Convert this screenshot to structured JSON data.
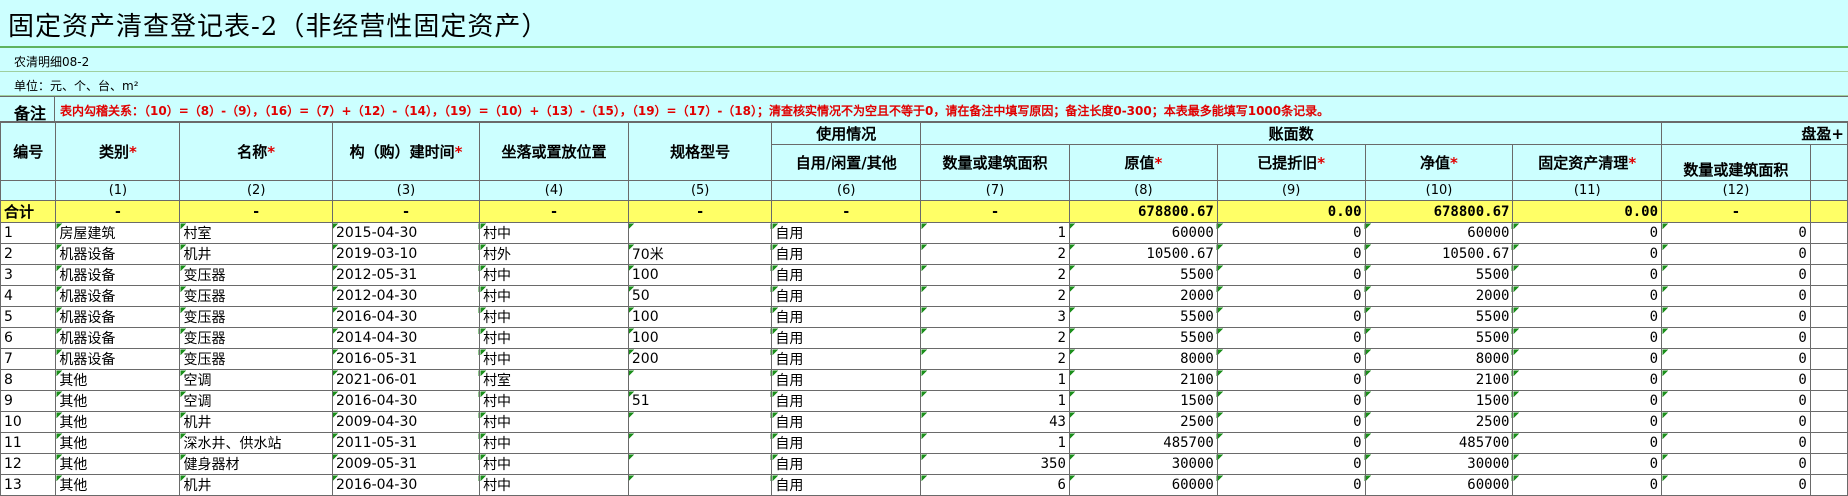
{
  "title": "固定资产清查登记表-2（非经营性固定资产）",
  "form_code": "农清明细08-2",
  "unit_line": "单位：元、个、台、m²",
  "note_label": "备注",
  "note_text": "表内勾稽关系：（10）=（8）-（9），（16）=（7）+（12）-（14），（19）=（10）+（13）-（15），（19）=（17）-（18）；清查核实情况不为空且不等于0，请在备注中填写原因；备注长度0-300；本表最多能填写1000条记录。",
  "headers": {
    "no": "编号",
    "category": "类别",
    "name": "名称",
    "build_time": "构（购）建时间",
    "location": "坐落或置放位置",
    "spec": "规格型号",
    "usage_group": "使用情况",
    "usage": "自用/闲置/其他",
    "book_group": "账面数",
    "quantity": "数量或建筑面积",
    "original": "原值",
    "depreciation": "已提折旧",
    "net": "净值",
    "cleanup": "固定资产清理",
    "surplus_group": "盘盈+",
    "surplus_qty": "数量或建筑面积",
    "required_mark": "*"
  },
  "column_index": [
    "(1)",
    "(2)",
    "(3)",
    "(4)",
    "(5)",
    "(6)",
    "(7)",
    "(8)",
    "(9)",
    "(10)",
    "(11)",
    "(12)"
  ],
  "summary": {
    "label": "合计",
    "dash": "-",
    "original": "678800.67",
    "depreciation": "0.00",
    "net": "678800.67",
    "cleanup": "0.00"
  },
  "rows": [
    {
      "no": "1",
      "category": "房屋建筑",
      "name": "村室",
      "time": "2015-04-30",
      "loc": "村中",
      "spec": "",
      "use": "自用",
      "qty": "1",
      "orig": "60000",
      "dep": "0",
      "net": "60000",
      "clean": "0",
      "surplus": "0"
    },
    {
      "no": "2",
      "category": "机器设备",
      "name": "机井",
      "time": "2019-03-10",
      "loc": "村外",
      "spec": "70米",
      "use": "自用",
      "qty": "2",
      "orig": "10500.67",
      "dep": "0",
      "net": "10500.67",
      "clean": "0",
      "surplus": "0"
    },
    {
      "no": "3",
      "category": "机器设备",
      "name": "变压器",
      "time": "2012-05-31",
      "loc": "村中",
      "spec": "100",
      "use": "自用",
      "qty": "2",
      "orig": "5500",
      "dep": "0",
      "net": "5500",
      "clean": "0",
      "surplus": "0"
    },
    {
      "no": "4",
      "category": "机器设备",
      "name": "变压器",
      "time": "2012-04-30",
      "loc": "村中",
      "spec": "50",
      "use": "自用",
      "qty": "2",
      "orig": "2000",
      "dep": "0",
      "net": "2000",
      "clean": "0",
      "surplus": "0"
    },
    {
      "no": "5",
      "category": "机器设备",
      "name": "变压器",
      "time": "2016-04-30",
      "loc": "村中",
      "spec": "100",
      "use": "自用",
      "qty": "3",
      "orig": "5500",
      "dep": "0",
      "net": "5500",
      "clean": "0",
      "surplus": "0"
    },
    {
      "no": "6",
      "category": "机器设备",
      "name": "变压器",
      "time": "2014-04-30",
      "loc": "村中",
      "spec": "100",
      "use": "自用",
      "qty": "2",
      "orig": "5500",
      "dep": "0",
      "net": "5500",
      "clean": "0",
      "surplus": "0"
    },
    {
      "no": "7",
      "category": "机器设备",
      "name": "变压器",
      "time": "2016-05-31",
      "loc": "村中",
      "spec": "200",
      "use": "自用",
      "qty": "2",
      "orig": "8000",
      "dep": "0",
      "net": "8000",
      "clean": "0",
      "surplus": "0"
    },
    {
      "no": "8",
      "category": "其他",
      "name": "空调",
      "time": "2021-06-01",
      "loc": "村室",
      "spec": "",
      "use": "自用",
      "qty": "1",
      "orig": "2100",
      "dep": "0",
      "net": "2100",
      "clean": "0",
      "surplus": "0"
    },
    {
      "no": "9",
      "category": "其他",
      "name": "空调",
      "time": "2016-04-30",
      "loc": "村中",
      "spec": "51",
      "use": "自用",
      "qty": "1",
      "orig": "1500",
      "dep": "0",
      "net": "1500",
      "clean": "0",
      "surplus": "0"
    },
    {
      "no": "10",
      "category": "其他",
      "name": "机井",
      "time": "2009-04-30",
      "loc": "村中",
      "spec": "",
      "use": "自用",
      "qty": "43",
      "orig": "2500",
      "dep": "0",
      "net": "2500",
      "clean": "0",
      "surplus": "0"
    },
    {
      "no": "11",
      "category": "其他",
      "name": "深水井、供水站",
      "time": "2011-05-31",
      "loc": "村中",
      "spec": "",
      "use": "自用",
      "qty": "1",
      "orig": "485700",
      "dep": "0",
      "net": "485700",
      "clean": "0",
      "surplus": "0"
    },
    {
      "no": "12",
      "category": "其他",
      "name": "健身器材",
      "time": "2009-05-31",
      "loc": "村中",
      "spec": "",
      "use": "自用",
      "qty": "350",
      "orig": "30000",
      "dep": "0",
      "net": "30000",
      "clean": "0",
      "surplus": "0"
    },
    {
      "no": "13",
      "category": "其他",
      "name": "机井",
      "time": "2016-04-30",
      "loc": "村中",
      "spec": "",
      "use": "自用",
      "qty": "6",
      "orig": "60000",
      "dep": "0",
      "net": "60000",
      "clean": "0",
      "surplus": "0"
    }
  ]
}
